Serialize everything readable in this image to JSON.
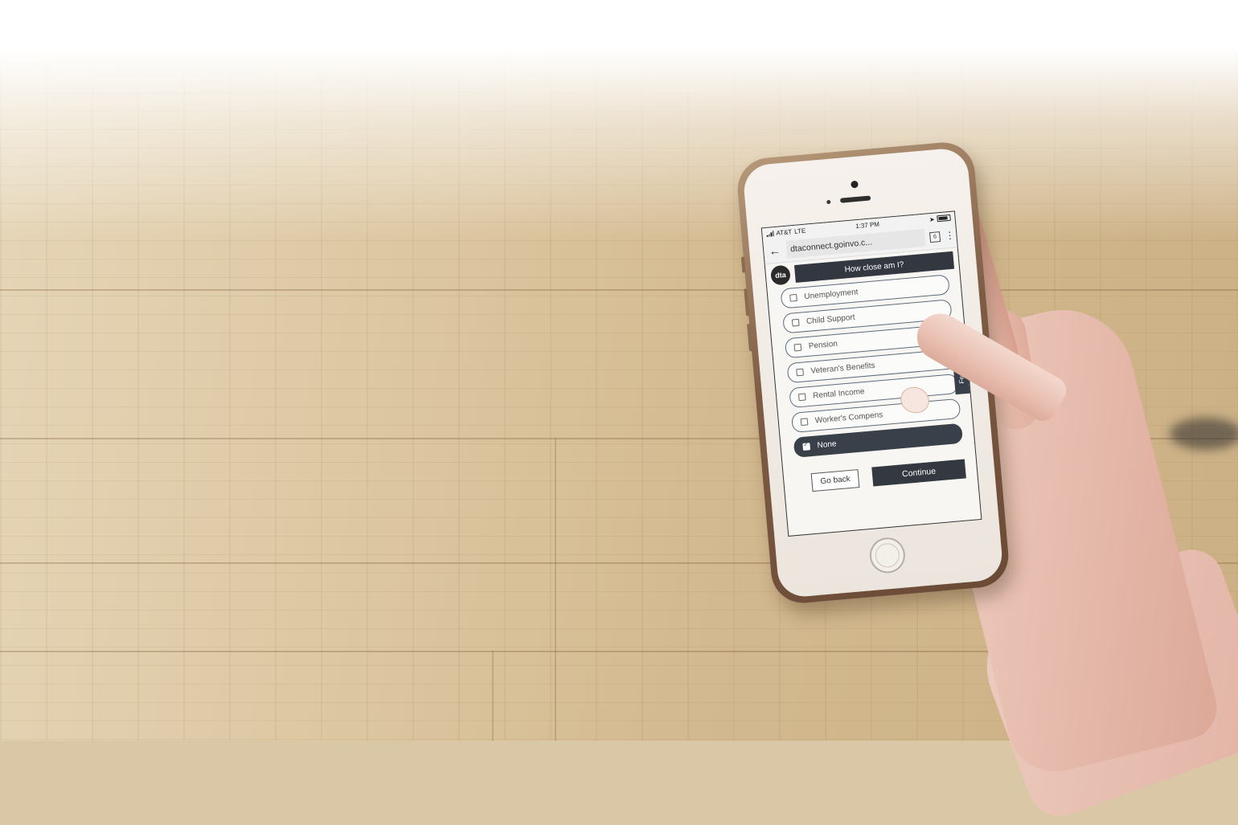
{
  "status_bar": {
    "carrier": "AT&T",
    "network": "LTE",
    "time": "1:37 PM"
  },
  "browser": {
    "back_icon": "arrow-left-icon",
    "url": "dtaconnect.goinvo.c...",
    "tab_count": "6",
    "menu_icon": "vertical-dots-icon"
  },
  "app": {
    "logo_text": "dta",
    "header_button": "How close am I?",
    "feedback_label": "Feedback",
    "options": [
      {
        "label": "Unemployment",
        "checked": false
      },
      {
        "label": "Child Support",
        "checked": false
      },
      {
        "label": "Pension",
        "checked": false
      },
      {
        "label": "Veteran's Benefits",
        "checked": false
      },
      {
        "label": "Rental Income",
        "checked": false
      },
      {
        "label": "Worker's Compens",
        "checked": false
      },
      {
        "label": "None",
        "checked": true
      }
    ],
    "go_back_label": "Go back",
    "continue_label": "Continue"
  },
  "colors": {
    "header_bg": "#333740",
    "selected_bg": "#3a4049",
    "option_border": "#5b6b7a"
  }
}
